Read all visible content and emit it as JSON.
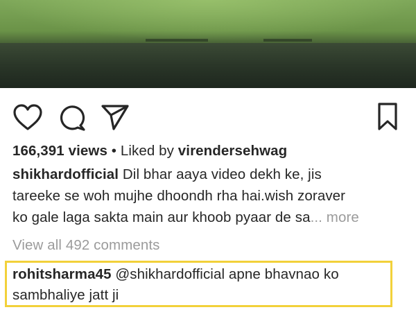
{
  "post": {
    "views_count": "166,391 views",
    "separator": " • ",
    "liked_by_prefix": "Liked by ",
    "liked_by_user": "virendersehwag",
    "author": "shikhardofficial",
    "caption_line1": " Dil bhar aaya video dekh ke, jis",
    "caption_line2": "tareeke se woh mujhe dhoondh rha hai.wish zoraver",
    "caption_line3": "ko gale laga sakta main aur khoob pyaar de sa",
    "ellipsis": "...",
    "more_label": " more",
    "view_comments_label": "View all 492 comments"
  },
  "comment": {
    "user": "rohitsharma45",
    "mention": " @shikhardofficial",
    "text_line1": " apne bhavnao ko",
    "text_line2": "sambhaliye jatt ji"
  },
  "icons": {
    "like": "heart-icon",
    "comment": "comment-bubble-icon",
    "share": "paper-plane-icon",
    "save": "bookmark-icon"
  },
  "colors": {
    "text": "#262626",
    "muted": "#9b9b9b",
    "highlight": "#f2d13a"
  }
}
